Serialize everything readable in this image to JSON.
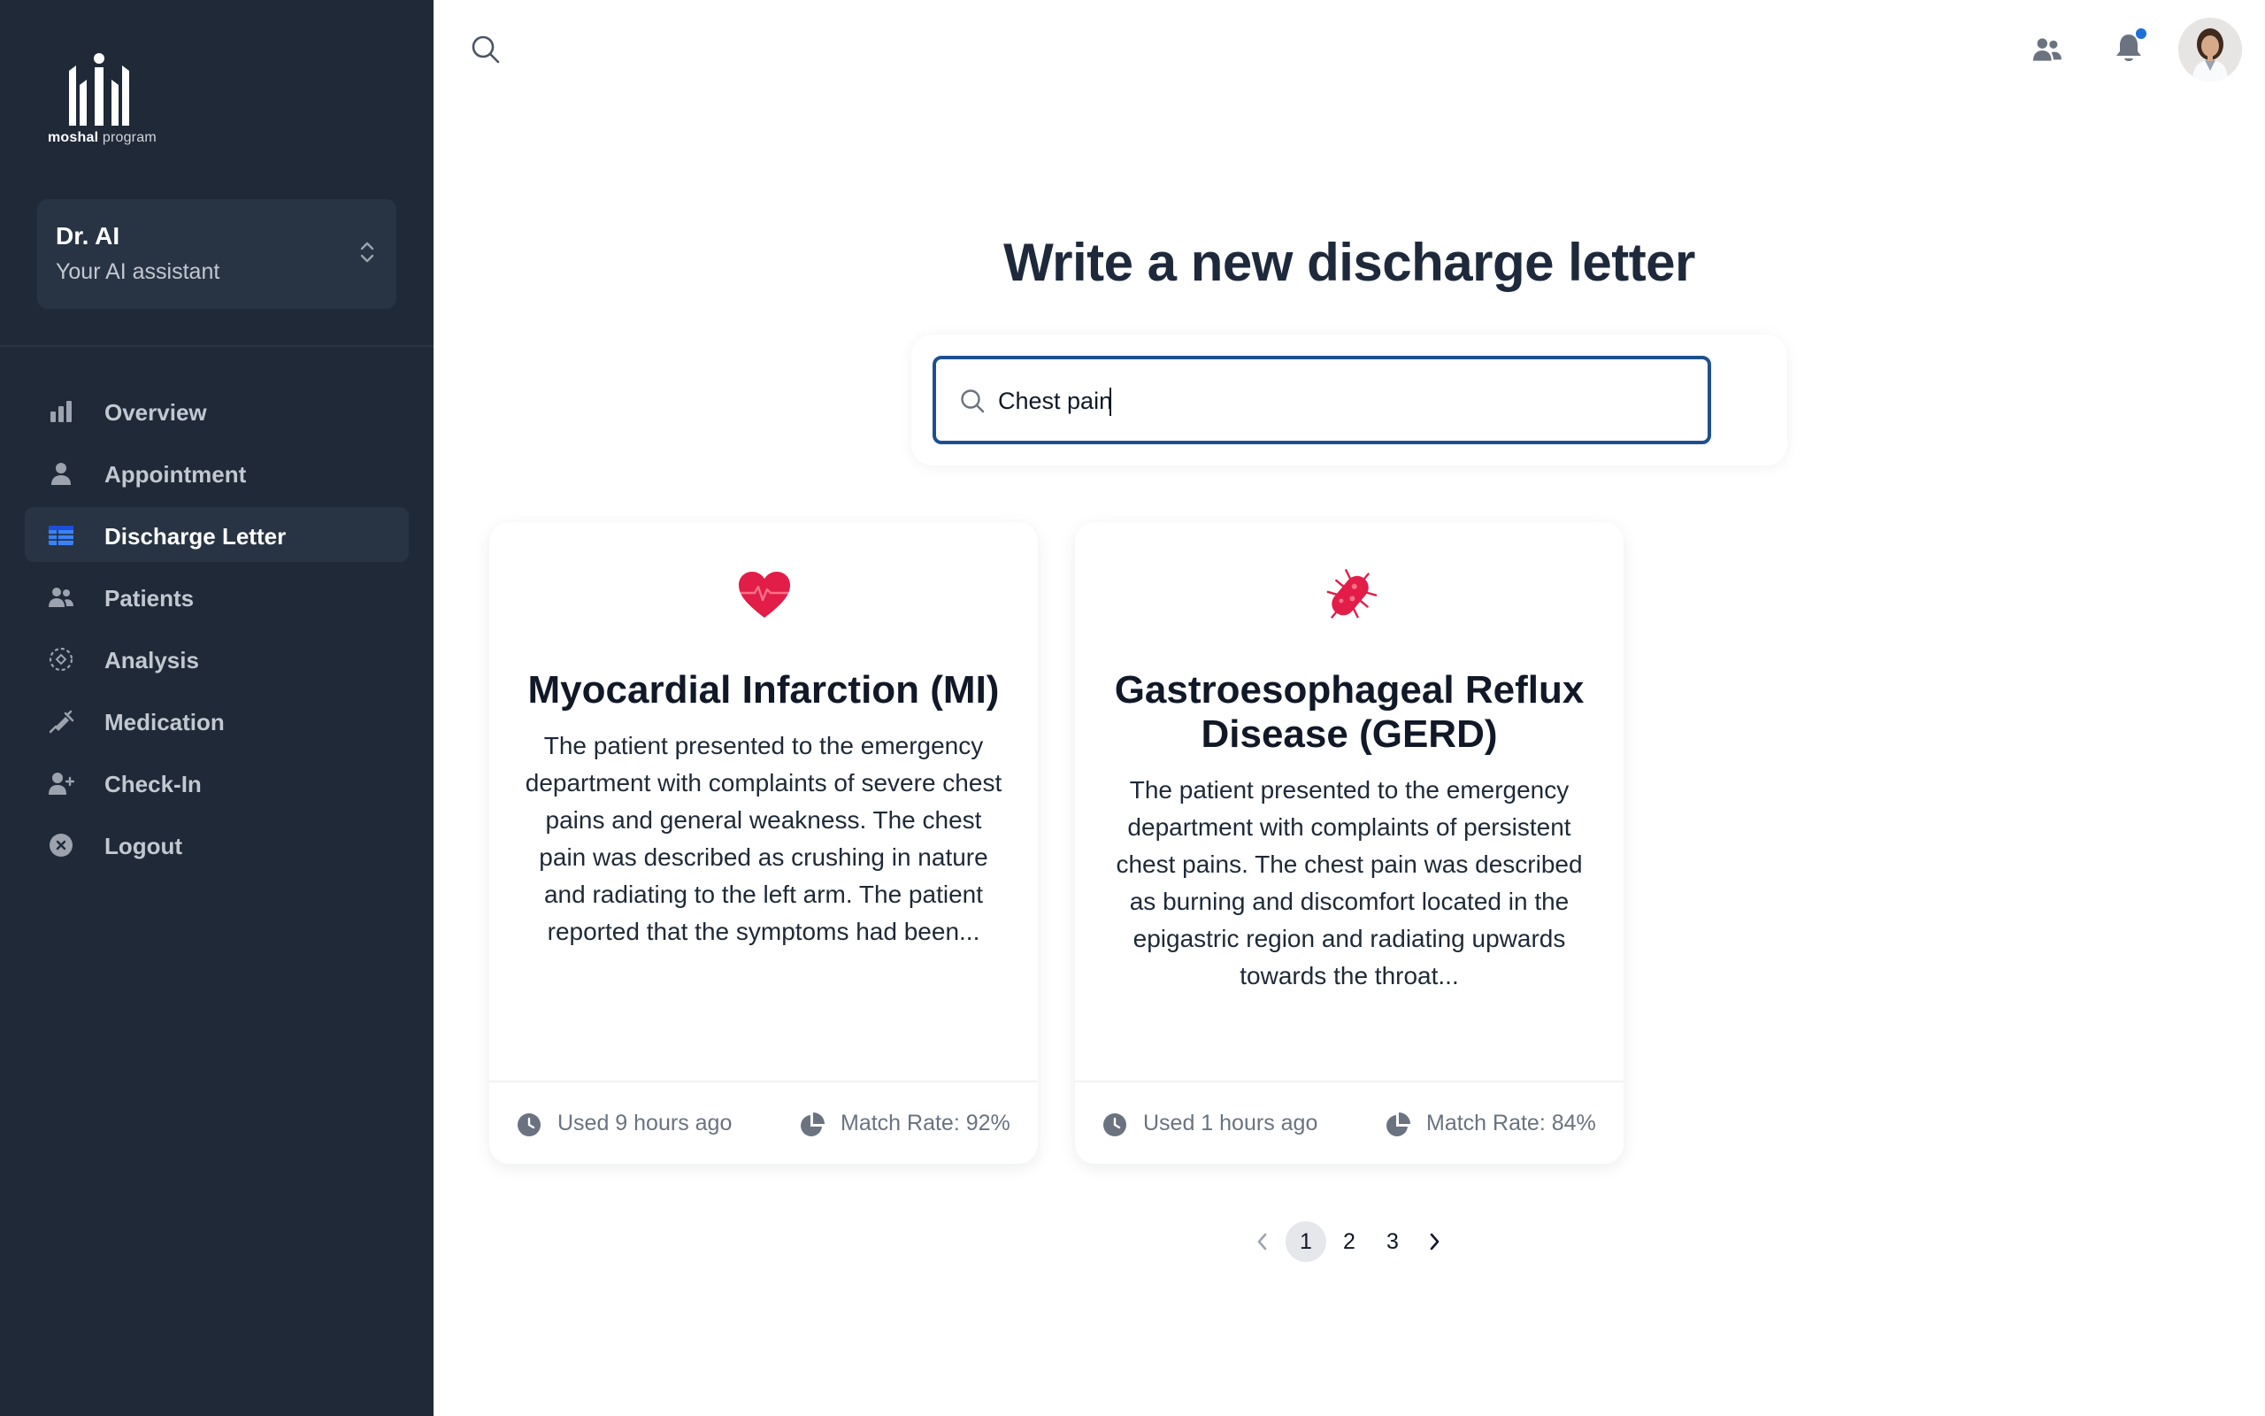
{
  "brand": {
    "name_bold": "moshal",
    "name_light": " program"
  },
  "assistant": {
    "name": "Dr. AI",
    "subtitle": "Your AI assistant"
  },
  "sidebar": {
    "items": [
      {
        "label": "Overview",
        "icon": "bar-chart-icon",
        "active": false
      },
      {
        "label": "Appointment",
        "icon": "user-icon",
        "active": false
      },
      {
        "label": "Discharge Letter",
        "icon": "table-icon",
        "active": true
      },
      {
        "label": "Patients",
        "icon": "users-icon",
        "active": false
      },
      {
        "label": "Analysis",
        "icon": "scan-icon",
        "active": false
      },
      {
        "label": "Medication",
        "icon": "syringe-icon",
        "active": false
      },
      {
        "label": "Check-In",
        "icon": "user-plus-icon",
        "active": false
      },
      {
        "label": "Logout",
        "icon": "x-circle-icon",
        "active": false
      }
    ]
  },
  "header": {
    "has_notification": true
  },
  "main": {
    "title": "Write a new discharge letter",
    "search": {
      "value": "Chest pain",
      "placeholder": ""
    },
    "cards": [
      {
        "icon": "heart-pulse-icon",
        "title": "Myocardial Infarction (MI)",
        "body": "The patient presented to the emergency department with complaints of severe chest pains and general weakness. The chest pain was described as crushing in nature and radiating to the left arm. The patient reported that the symptoms had been...",
        "used": "Used 9 hours ago",
        "match": "Match Rate: 92%"
      },
      {
        "icon": "bacteria-icon",
        "title": "Gastroesophageal Reflux Disease (GERD)",
        "body": "The patient presented to the emergency department with complaints of persistent chest pains. The chest pain was described as burning and discomfort located in the epigastric region and radiating upwards towards the throat...",
        "used": "Used 1 hours ago",
        "match": "Match Rate: 84%"
      }
    ],
    "pagination": {
      "pages": [
        "1",
        "2",
        "3"
      ],
      "current": "1"
    }
  },
  "colors": {
    "sidebar_bg": "#1f2937",
    "accent": "#1e4f8f",
    "icon_red": "#e11d48",
    "notification_dot": "#1d6fd6"
  }
}
